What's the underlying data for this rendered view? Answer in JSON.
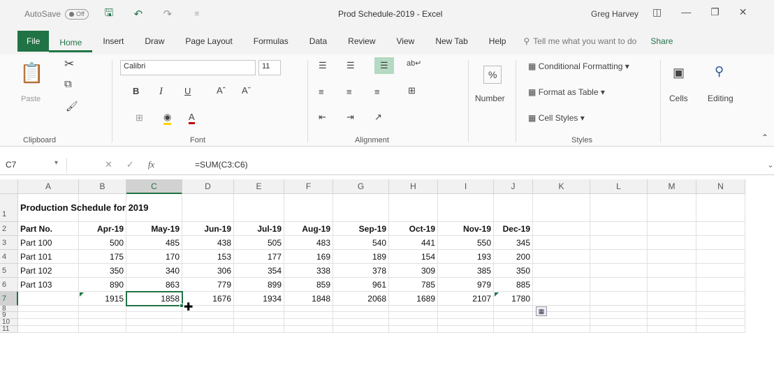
{
  "window": {
    "autosave_label": "AutoSave",
    "autosave_state": "Off",
    "title": "Prod Schedule-2019 - Excel",
    "user": "Greg Harvey"
  },
  "tabs": [
    "File",
    "Home",
    "Insert",
    "Draw",
    "Page Layout",
    "Formulas",
    "Data",
    "Review",
    "View",
    "New Tab",
    "Help"
  ],
  "active_tab": "Home",
  "tell_me": "Tell me what you want to do",
  "share": "Share",
  "ribbon": {
    "clipboard": {
      "paste": "Paste",
      "label": "Clipboard"
    },
    "font": {
      "name": "Calibri",
      "size": "11",
      "bold": "B",
      "italic": "I",
      "underline": "U",
      "label": "Font"
    },
    "alignment": {
      "label": "Alignment"
    },
    "number": {
      "label": "Number"
    },
    "styles": {
      "conditional": "Conditional Formatting",
      "format_table": "Format as Table",
      "cell_styles": "Cell Styles",
      "label": "Styles"
    },
    "cells": {
      "label": "Cells"
    },
    "editing": {
      "label": "Editing"
    }
  },
  "formula_bar": {
    "name_box": "C7",
    "formula": "=SUM(C3:C6)",
    "fx": "fx"
  },
  "columns": [
    "A",
    "B",
    "C",
    "D",
    "E",
    "F",
    "G",
    "H",
    "I",
    "J",
    "K",
    "L",
    "M",
    "N"
  ],
  "rows": [
    "1",
    "2",
    "3",
    "4",
    "5",
    "6",
    "7",
    "8",
    "9",
    "10",
    "11"
  ],
  "sheet": {
    "title": "Production Schedule for 2019",
    "header": [
      "Part No.",
      "Apr-19",
      "May-19",
      "Jun-19",
      "Jul-19",
      "Aug-19",
      "Sep-19",
      "Oct-19",
      "Nov-19",
      "Dec-19"
    ],
    "data": [
      [
        "Part 100",
        "500",
        "485",
        "438",
        "505",
        "483",
        "540",
        "441",
        "550",
        "345"
      ],
      [
        "Part 101",
        "175",
        "170",
        "153",
        "177",
        "169",
        "189",
        "154",
        "193",
        "200"
      ],
      [
        "Part 102",
        "350",
        "340",
        "306",
        "354",
        "338",
        "378",
        "309",
        "385",
        "350"
      ],
      [
        "Part 103",
        "890",
        "863",
        "779",
        "899",
        "859",
        "961",
        "785",
        "979",
        "885"
      ]
    ],
    "totals": [
      "",
      "1915",
      "1858",
      "1676",
      "1934",
      "1848",
      "2068",
      "1689",
      "2107",
      "1780"
    ]
  },
  "colors": {
    "accent": "#217346"
  }
}
